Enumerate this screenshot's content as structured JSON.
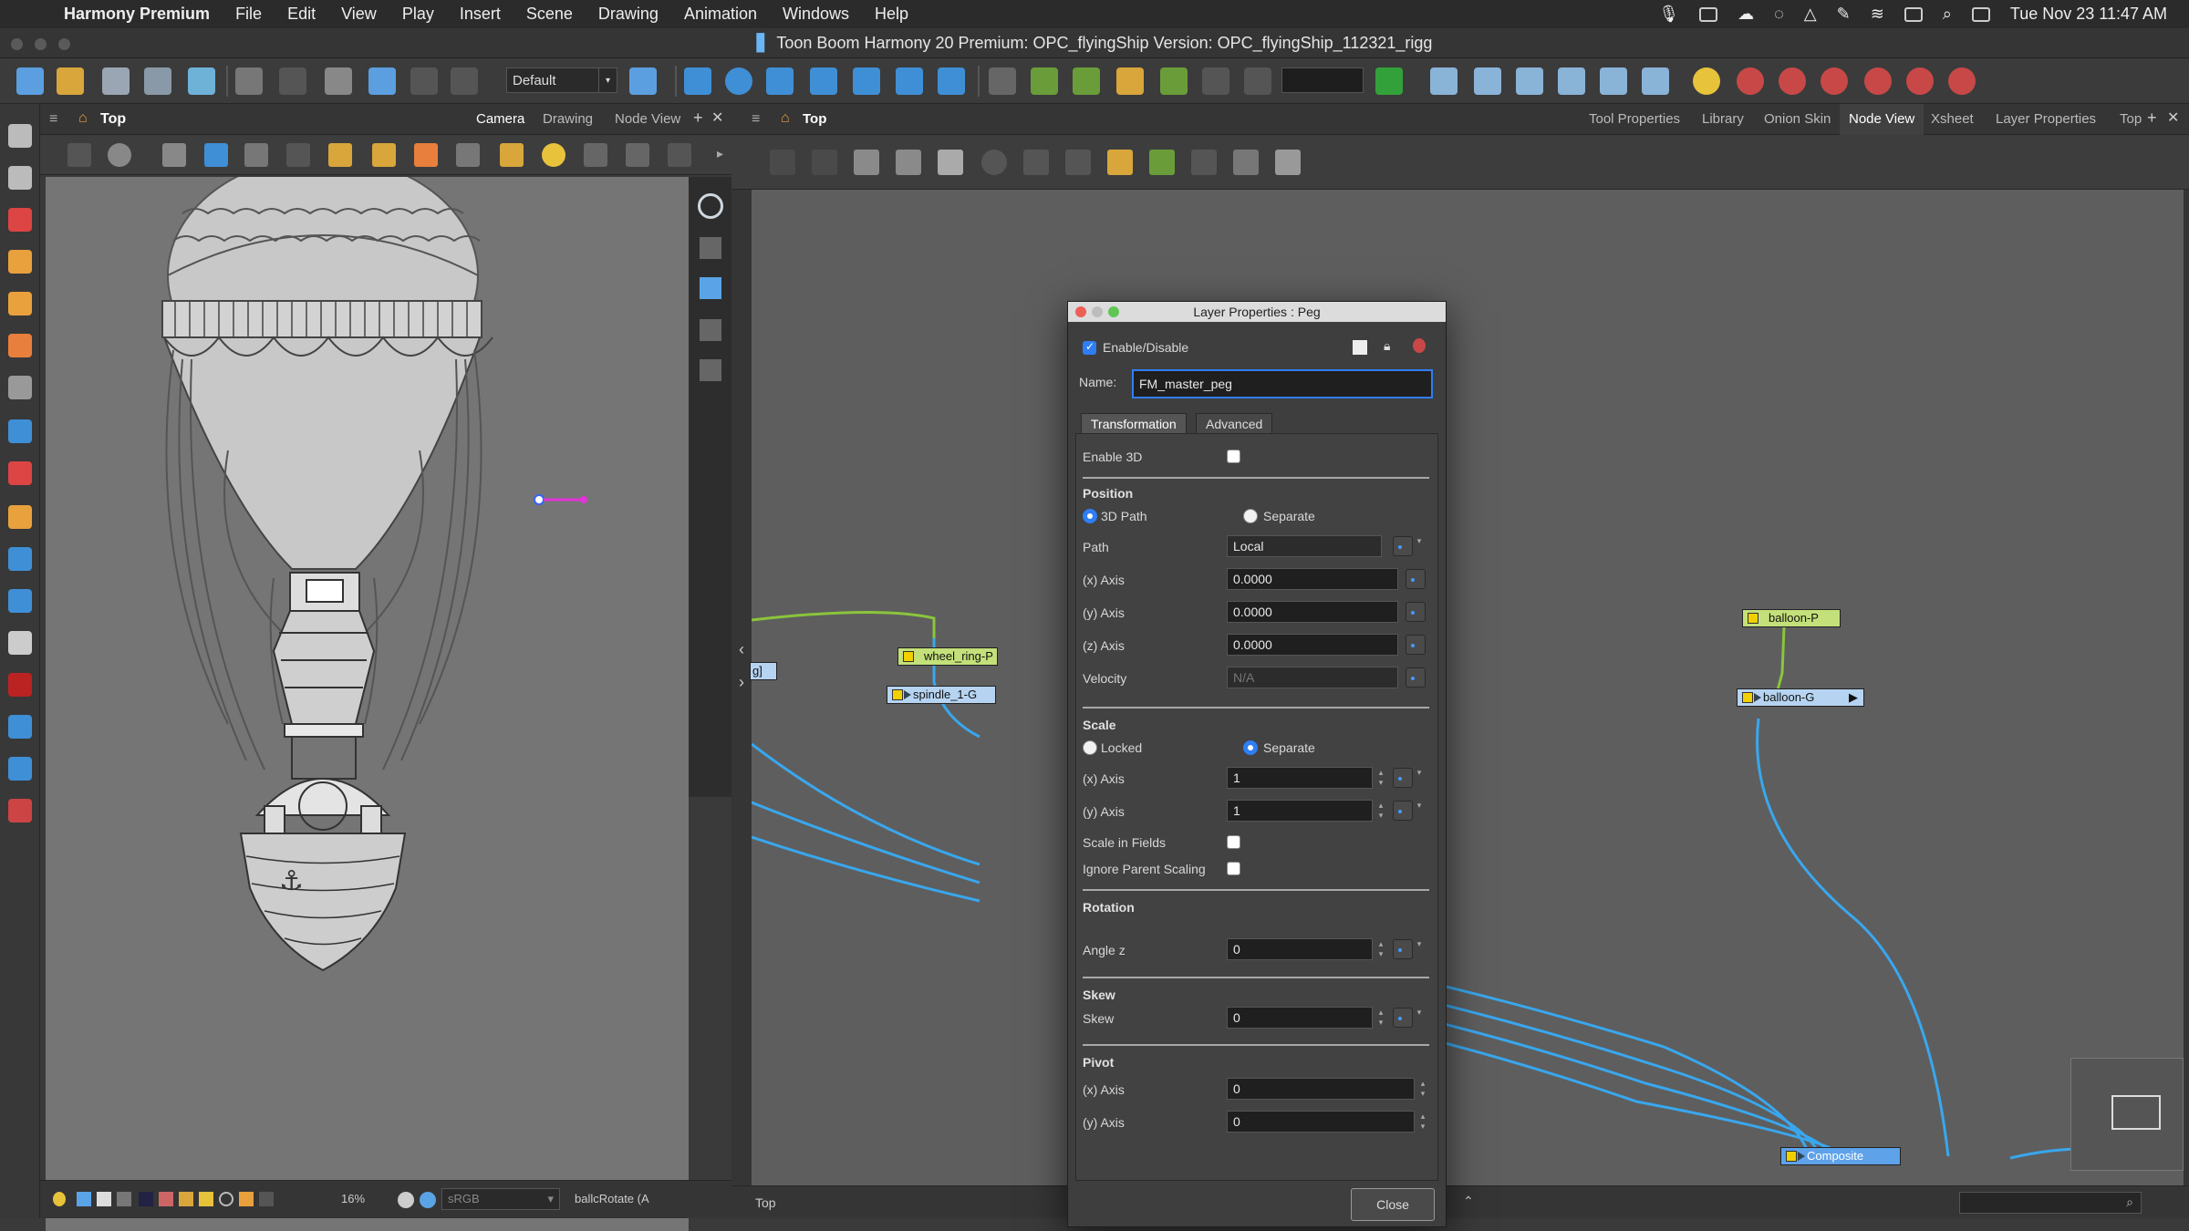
{
  "menubar": {
    "app_name": "Harmony Premium",
    "items": [
      "File",
      "Edit",
      "View",
      "Play",
      "Insert",
      "Scene",
      "Drawing",
      "Animation",
      "Windows",
      "Help"
    ],
    "datetime": "Tue Nov 23  11:47 AM"
  },
  "window": {
    "title": "Toon Boom Harmony 20 Premium: OPC_flyingShip Version: OPC_flyingShip_112321_rigg"
  },
  "toolbar": {
    "preset_value": "Default"
  },
  "camera_panel": {
    "view_label": "Top",
    "tabs": [
      "Camera",
      "Drawing",
      "Node View"
    ],
    "active_tab": "Camera",
    "zoom": "16%",
    "color_space": "sRGB",
    "status_text": "ballcRotate (A"
  },
  "node_panel": {
    "view_label": "Top",
    "tabs": [
      "Tool Properties",
      "Library",
      "Onion Skin",
      "Node View",
      "Xsheet",
      "Layer Properties",
      "Top"
    ],
    "active_tab": "Node View",
    "status_text": "Top",
    "nodes": {
      "wheel_ring": "wheel_ring-P",
      "spindle": "spindle_1-G",
      "left_partial": "g]",
      "balloon_p": "balloon-P",
      "balloon_g": "balloon-G",
      "composite": "Composite"
    }
  },
  "dialog": {
    "title": "Layer Properties : Peg",
    "enable_label": "Enable/Disable",
    "name_label": "Name:",
    "name_value": "FM_master_peg",
    "tabs": [
      "Transformation",
      "Advanced"
    ],
    "enable3d_label": "Enable 3D",
    "position": {
      "header": "Position",
      "mode_3dpath": "3D Path",
      "mode_separate": "Separate",
      "path_label": "Path",
      "path_value": "Local",
      "x_label": "(x) Axis",
      "x_value": "0.0000",
      "y_label": "(y) Axis",
      "y_value": "0.0000",
      "z_label": "(z) Axis",
      "z_value": "0.0000",
      "velocity_label": "Velocity",
      "velocity_value": "N/A"
    },
    "scale": {
      "header": "Scale",
      "locked": "Locked",
      "separate": "Separate",
      "x_label": "(x) Axis",
      "x_value": "1",
      "y_label": "(y) Axis",
      "y_value": "1",
      "fields_label": "Scale in Fields",
      "ignore_parent_label": "Ignore Parent Scaling"
    },
    "rotation": {
      "header": "Rotation",
      "angle_label": "Angle z",
      "angle_value": "0"
    },
    "skew": {
      "header": "Skew",
      "skew_label": "Skew",
      "skew_value": "0"
    },
    "pivot": {
      "header": "Pivot",
      "x_label": "(x) Axis",
      "x_value": "0",
      "y_label": "(y) Axis",
      "y_value": "0"
    },
    "close_label": "Close"
  },
  "colors": {
    "accent": "#2f7ef6",
    "node_wire": "#39a7ee",
    "green_wire": "#8ac53b",
    "peg_node": "#c4e07a",
    "group_node": "#b6d4f1",
    "composite_node": "#5ea2ea"
  }
}
